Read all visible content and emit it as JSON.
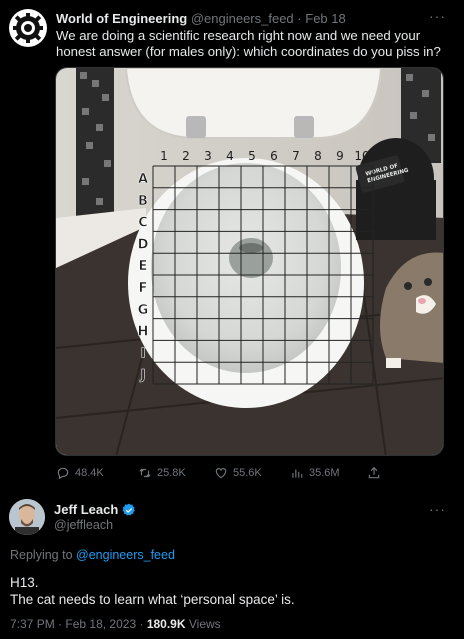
{
  "original_tweet": {
    "display_name": "World of Engineering",
    "handle": "@engineers_feed",
    "separator": "·",
    "date": "Feb 18",
    "text": "We are doing a scientific research right now and we need your honest answer (for males only): which coordinates do you piss in?",
    "more_icon": "more-dots-icon",
    "image": {
      "grid_columns": [
        "1",
        "2",
        "3",
        "4",
        "5",
        "6",
        "7",
        "8",
        "9",
        "10"
      ],
      "grid_rows": [
        "A",
        "B",
        "C",
        "D",
        "E",
        "F",
        "G",
        "H",
        "I",
        "J"
      ],
      "box_label_line1": "WORLD OF",
      "box_label_line2": "ENGINEERING"
    },
    "actions": {
      "replies": "48.4K",
      "retweets": "25.8K",
      "likes": "55.6K",
      "views": "35.6M"
    }
  },
  "reply": {
    "display_name": "Jeff Leach",
    "handle": "@jeffleach",
    "verified_icon": "verified-badge-icon",
    "replying_prefix": "Replying to",
    "replying_to": "@engineers_feed",
    "text_line1": "H13.",
    "text_line2": "The cat needs to learn what ‘personal space’ is.",
    "time": "7:37 PM",
    "separator": "·",
    "date": "Feb 18, 2023",
    "separator2": "·",
    "views_count": "180.9K",
    "views_label": "Views"
  },
  "colors": {
    "background": "#000000",
    "text": "#e7e9ea",
    "muted": "#71767b",
    "link": "#1d9bf0"
  }
}
